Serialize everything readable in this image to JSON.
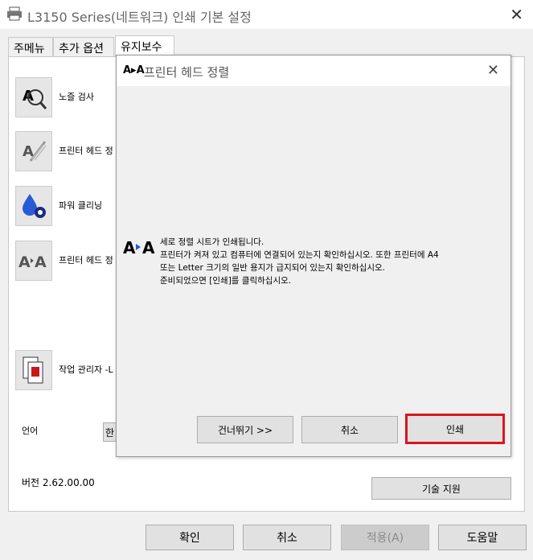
{
  "window": {
    "title": "L3150 Series(네트워크) 인쇄 기본 설정",
    "close": "✕"
  },
  "tabs": [
    "주메뉴",
    "추가 옵션",
    "유지보수"
  ],
  "menu": [
    {
      "label": "노즐 검사",
      "icon": "nozzle-check-icon"
    },
    {
      "label": "프린터 헤드 정",
      "icon": "head-cleaning-icon"
    },
    {
      "label": "파워 클리닝",
      "icon": "power-cleaning-icon"
    },
    {
      "label": "프린터 헤드 정",
      "icon": "head-alignment-icon"
    },
    {
      "label": "작업 관리자 -L",
      "icon": "job-manager-icon"
    }
  ],
  "language": {
    "label": "언어",
    "value": "한"
  },
  "version": "버전 2.62.00.00",
  "support_button": "기술 지원",
  "dialog": {
    "icon_text": "A▸A",
    "title": "프린터 헤드 정렬",
    "close": "✕",
    "message": [
      "세로 정렬 시트가 인쇄됩니다.",
      "프린터가 켜져 있고 컴퓨터에 연결되어 있는지 확인하십시오. 또한 프린터에 A4",
      "또는 Letter 크기의 일반 용지가 급지되어 있는지 확인하십시오.",
      "준비되었으면 [인쇄]를 클릭하십시오."
    ],
    "buttons": {
      "skip": "건너뛰기 >>",
      "cancel": "취소",
      "print": "인쇄"
    },
    "highlight_color": "#d9161e"
  },
  "footer": {
    "ok": "확인",
    "cancel": "취소",
    "apply": "적용(A)",
    "help": "도움말"
  }
}
